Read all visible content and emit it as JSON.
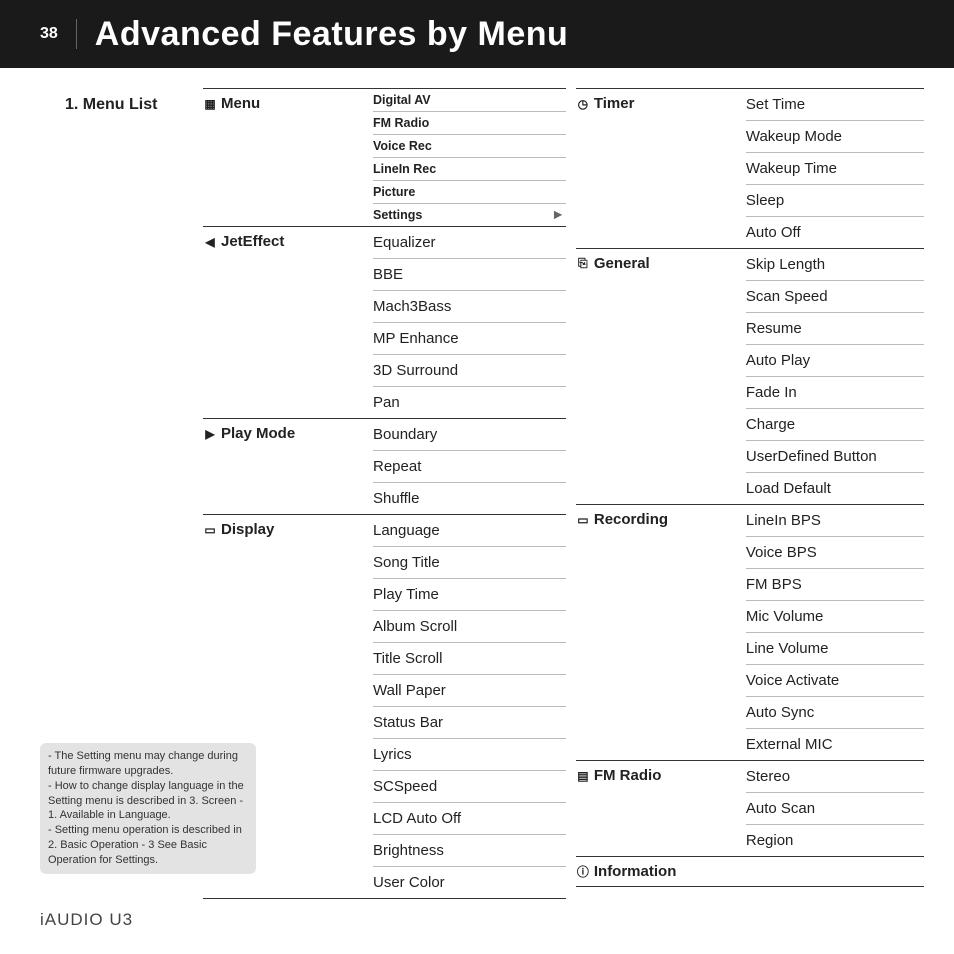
{
  "header": {
    "page_number": "38",
    "title": "Advanced Features by Menu"
  },
  "section": {
    "title": "1. Menu List"
  },
  "column1": [
    {
      "label": "Menu",
      "icon": "menu-grid-icon",
      "compact": true,
      "items": [
        {
          "text": "Digital AV"
        },
        {
          "text": "FM Radio"
        },
        {
          "text": "Voice Rec"
        },
        {
          "text": "LineIn Rec"
        },
        {
          "text": "Picture"
        },
        {
          "text": "Settings",
          "arrow": true
        }
      ]
    },
    {
      "label": "JetEffect",
      "icon": "speaker-icon",
      "items": [
        {
          "text": "Equalizer"
        },
        {
          "text": "BBE"
        },
        {
          "text": "Mach3Bass"
        },
        {
          "text": "MP Enhance"
        },
        {
          "text": "3D Surround"
        },
        {
          "text": "Pan"
        }
      ]
    },
    {
      "label": "Play Mode",
      "icon": "play-icon",
      "items": [
        {
          "text": "Boundary"
        },
        {
          "text": "Repeat"
        },
        {
          "text": "Shuffle"
        }
      ]
    },
    {
      "label": "Display",
      "icon": "display-icon",
      "items": [
        {
          "text": "Language"
        },
        {
          "text": "Song Title"
        },
        {
          "text": "Play Time"
        },
        {
          "text": "Album Scroll"
        },
        {
          "text": "Title Scroll"
        },
        {
          "text": "Wall Paper"
        },
        {
          "text": "Status Bar"
        },
        {
          "text": "Lyrics"
        },
        {
          "text": "SCSpeed"
        },
        {
          "text": "LCD Auto Off"
        },
        {
          "text": "Brightness"
        },
        {
          "text": "User Color"
        }
      ]
    }
  ],
  "column2": [
    {
      "label": "Timer",
      "icon": "clock-icon",
      "items": [
        {
          "text": "Set Time"
        },
        {
          "text": "Wakeup Mode"
        },
        {
          "text": "Wakeup Time"
        },
        {
          "text": "Sleep"
        },
        {
          "text": "Auto Off"
        }
      ]
    },
    {
      "label": "General",
      "icon": "general-icon",
      "items": [
        {
          "text": "Skip Length"
        },
        {
          "text": "Scan Speed"
        },
        {
          "text": "Resume"
        },
        {
          "text": "Auto Play"
        },
        {
          "text": "Fade In"
        },
        {
          "text": "Charge"
        },
        {
          "text": "UserDefined Button"
        },
        {
          "text": "Load Default"
        }
      ]
    },
    {
      "label": "Recording",
      "icon": "recording-icon",
      "items": [
        {
          "text": "LineIn BPS"
        },
        {
          "text": "Voice BPS"
        },
        {
          "text": "FM BPS"
        },
        {
          "text": "Mic Volume"
        },
        {
          "text": "Line Volume"
        },
        {
          "text": "Voice Activate"
        },
        {
          "text": "Auto Sync"
        },
        {
          "text": "External MIC"
        }
      ]
    },
    {
      "label": "FM Radio",
      "icon": "radio-icon",
      "items": [
        {
          "text": "Stereo"
        },
        {
          "text": "Auto Scan"
        },
        {
          "text": "Region"
        }
      ]
    },
    {
      "label": "Information",
      "icon": "info-icon",
      "label_only": true
    }
  ],
  "note": {
    "lines": [
      "- The Setting menu may change during future firmware upgrades.",
      "- How to change display language in the Setting menu is described in 3. Screen - 1. Available in Language.",
      "- Setting menu operation is described in 2. Basic Operation - 3 See Basic Operation for Settings."
    ]
  },
  "footer": {
    "product": "iAUDIO U3"
  },
  "icons": {
    "menu-grid-icon": "▦",
    "speaker-icon": "◀",
    "play-icon": "▶",
    "display-icon": "▭",
    "clock-icon": "◷",
    "general-icon": "⎘",
    "recording-icon": "▭",
    "radio-icon": "▤",
    "info-icon": "ⓘ"
  }
}
